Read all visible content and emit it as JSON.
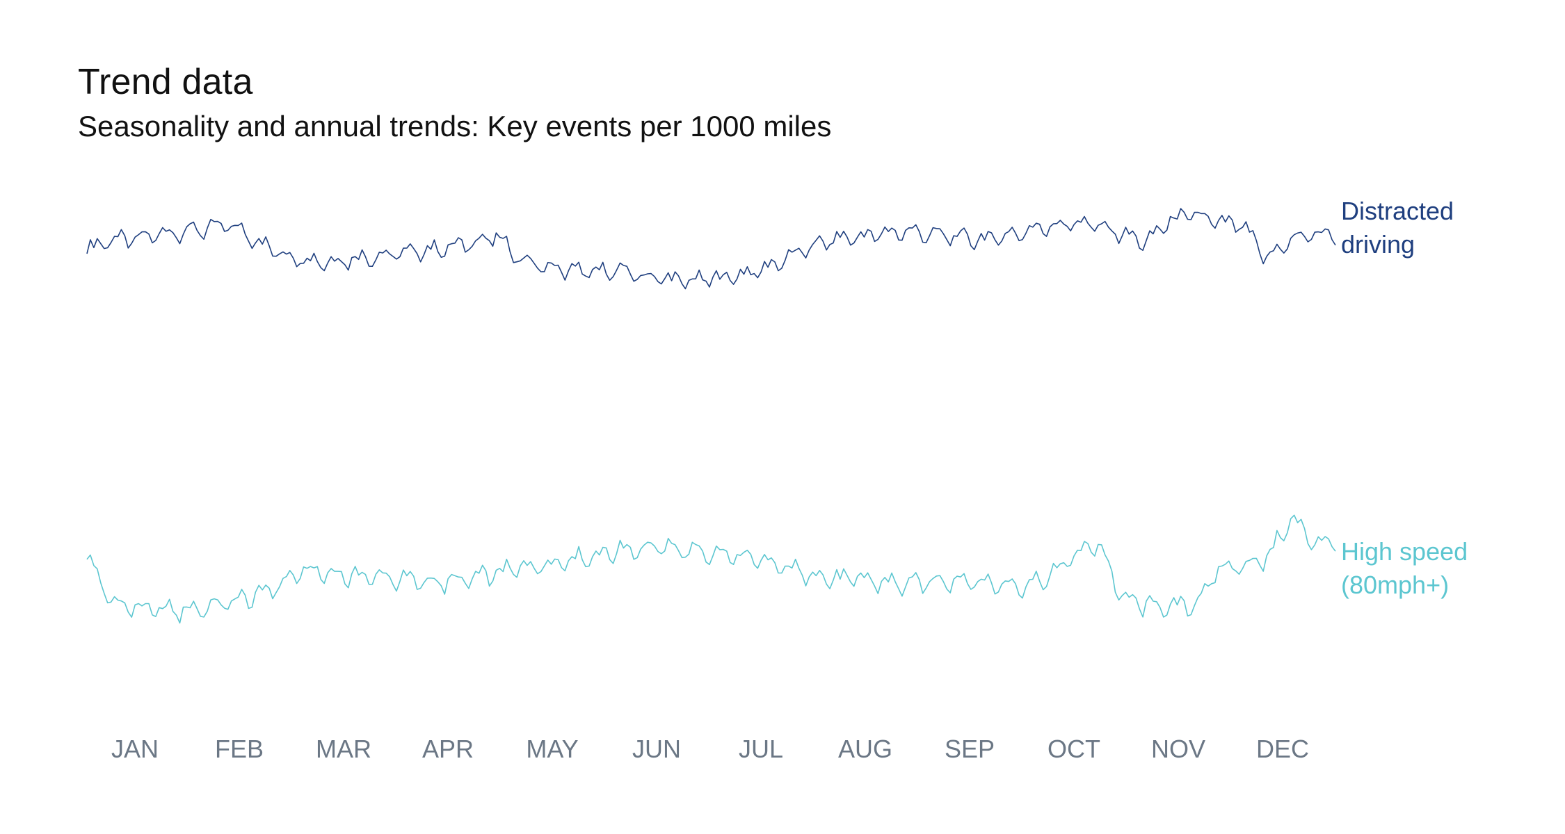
{
  "chart_data": {
    "type": "line",
    "title": "Trend data",
    "subtitle": "Seasonality and annual trends: Key events per 1000 miles",
    "xlabel": "",
    "ylabel": "",
    "grid": false,
    "legend_placement": "right (inline labels at line ends)",
    "x_tick_labels": [
      "JAN",
      "FEB",
      "MAR",
      "APR",
      "MAY",
      "JUN",
      "JUL",
      "AUG",
      "SEP",
      "OCT",
      "NOV",
      "DEC"
    ],
    "y_note": "No y-axis shown; values are relative index (0-100) within each series' own band",
    "series": [
      {
        "name": "Distracted driving",
        "label_lines": [
          "Distracted",
          "driving"
        ],
        "color": "#1f3f7f",
        "weekly_level": [
          55,
          62,
          62,
          66,
          68,
          70,
          72,
          62,
          52,
          48,
          46,
          48,
          50,
          52,
          54,
          56,
          60,
          64,
          48,
          42,
          40,
          38,
          40,
          36,
          34,
          32,
          34,
          36,
          40,
          48,
          56,
          62,
          64,
          66,
          68,
          66,
          64,
          62,
          64,
          68,
          72,
          74,
          72,
          66,
          60,
          76,
          80,
          74,
          72,
          48,
          62,
          66
        ],
        "weekly_amplitude": 10
      },
      {
        "name": "High speed (80mph+)",
        "label_lines": [
          "High speed",
          "(80mph+)"
        ],
        "color": "#5cc6d0",
        "weekly_level": [
          60,
          28,
          24,
          22,
          22,
          24,
          28,
          32,
          40,
          50,
          48,
          46,
          46,
          44,
          42,
          42,
          44,
          48,
          52,
          54,
          58,
          60,
          64,
          66,
          66,
          64,
          62,
          60,
          56,
          52,
          48,
          44,
          44,
          42,
          40,
          42,
          44,
          42,
          40,
          40,
          46,
          60,
          70,
          30,
          26,
          24,
          26,
          50,
          54,
          58,
          86,
          70
        ],
        "weekly_amplitude": 12
      }
    ]
  }
}
